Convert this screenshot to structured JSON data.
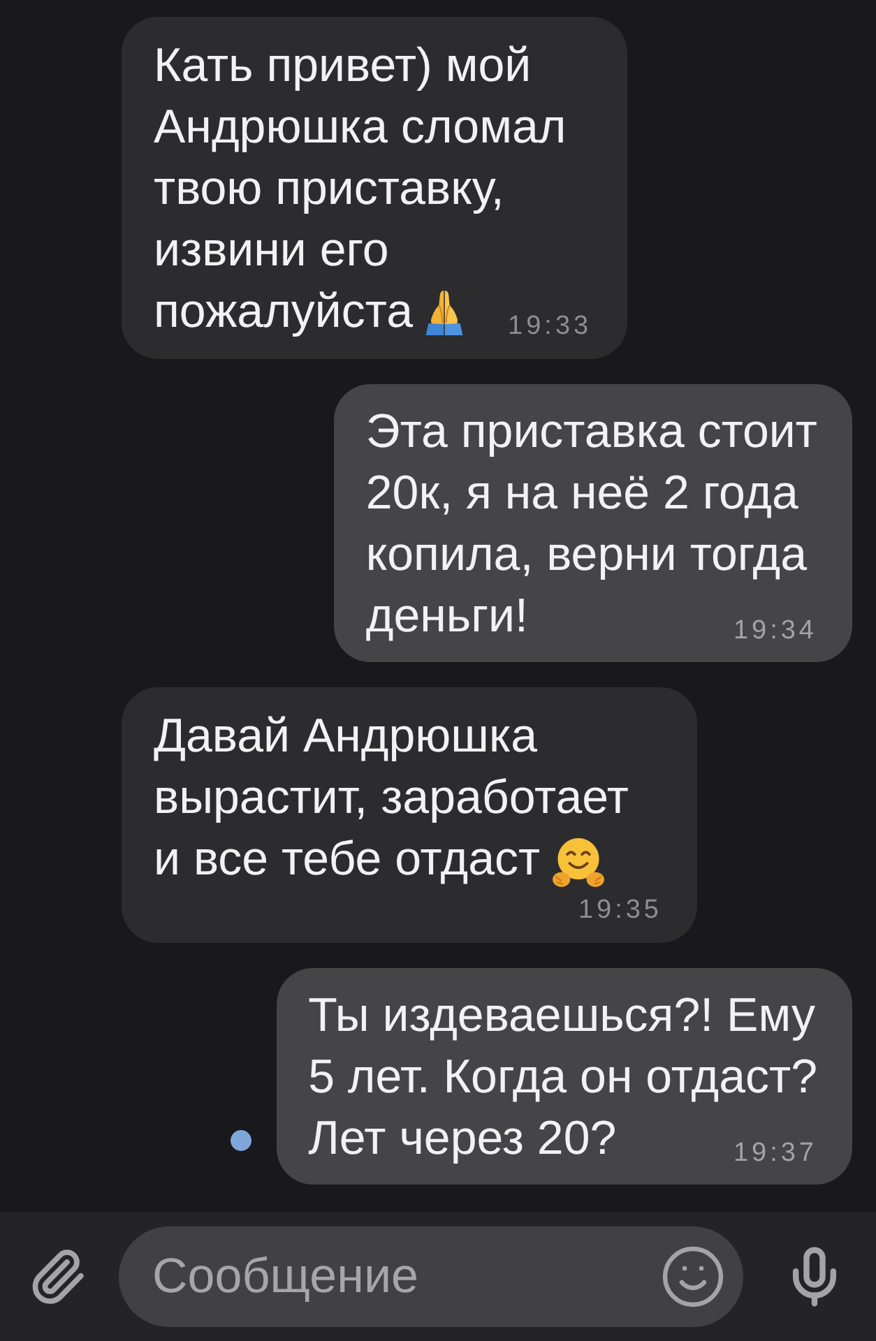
{
  "messages": [
    {
      "kind": "incoming",
      "lines": [
        "Кать привет) мой",
        "Андрюшка сломал",
        "твою приставку,",
        "извини его",
        "пожалуйста"
      ],
      "emoji": {
        "kind": "pray"
      },
      "time": "19:33",
      "unread": false
    },
    {
      "kind": "outgoing",
      "lines": [
        "Эта приставка стоит",
        "20к, я на неё 2 года",
        "копила, верни тогда",
        "деньги!"
      ],
      "time": "19:34",
      "unread": false
    },
    {
      "kind": "incoming",
      "lines": [
        "Давай Андрюшка",
        "вырастит, заработает",
        "и все тебе отдаст"
      ],
      "emoji": {
        "kind": "hug"
      },
      "time": "19:35",
      "unread": false
    },
    {
      "kind": "outgoing",
      "lines": [
        "Ты издеваешься?! Ему",
        "5 лет. Когда он отдаст?",
        "Лет через 20?"
      ],
      "time": "19:37",
      "unread": true
    }
  ],
  "composer": {
    "placeholder": "Сообщение"
  }
}
